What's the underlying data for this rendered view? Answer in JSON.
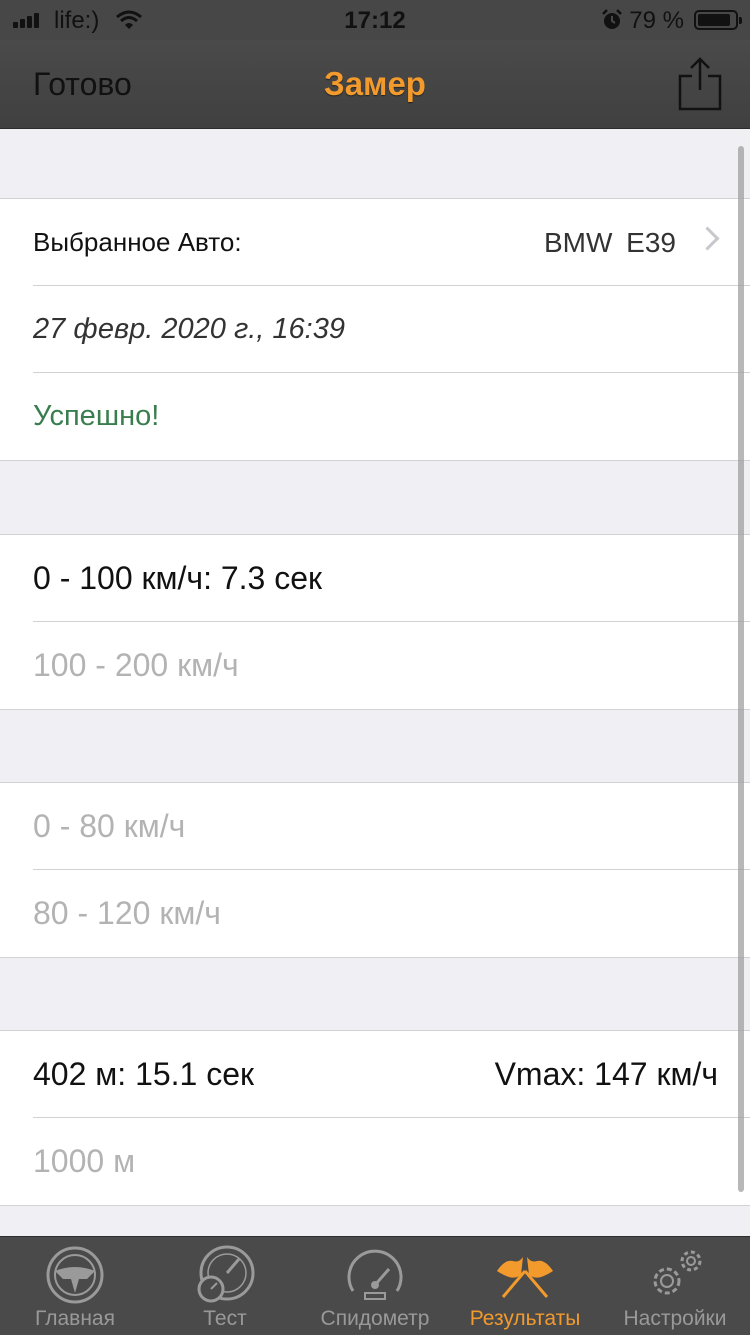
{
  "status_bar": {
    "carrier": "life:)",
    "time": "17:12",
    "battery": "79 %"
  },
  "nav": {
    "done": "Готово",
    "title": "Замер"
  },
  "car_section": {
    "label": "Выбранное Авто:",
    "car": "BMW  E39",
    "date": "27 февр. 2020 г., 16:39",
    "status": "Успешно!"
  },
  "accel_section": {
    "row1": "0 - 100 км/ч: 7.3 сек",
    "row2": "100 - 200 км/ч"
  },
  "accel2_section": {
    "row1": "0 - 80 км/ч",
    "row2": "80 - 120 км/ч"
  },
  "distance_section": {
    "row1_left": "402 м: 15.1 сек",
    "row1_right": "Vmax: 147 км/ч",
    "row2": "1000 м"
  },
  "tabs": [
    {
      "label": "Главная",
      "icon": "steering-wheel-icon"
    },
    {
      "label": "Тест",
      "icon": "gauges-icon"
    },
    {
      "label": "Спидометр",
      "icon": "speedometer-icon"
    },
    {
      "label": "Результаты",
      "icon": "checkered-flags-icon",
      "active": true
    },
    {
      "label": "Настройки",
      "icon": "gears-icon"
    }
  ],
  "colors": {
    "accent": "#f39a2c",
    "success": "#3a7d4e",
    "bar": "#4a4a4a"
  }
}
